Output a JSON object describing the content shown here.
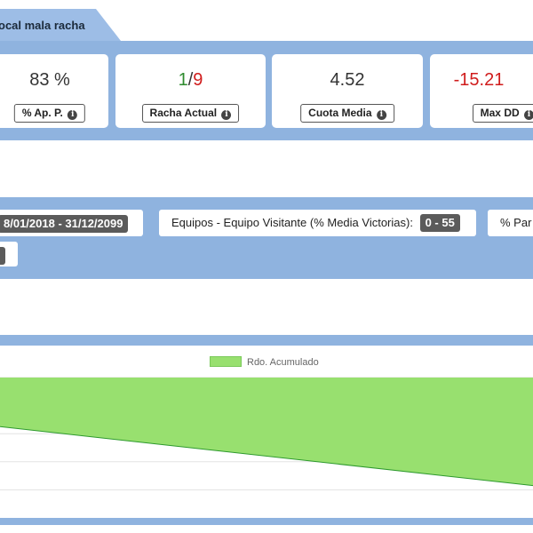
{
  "header": {
    "tab_title": "ocal mala racha"
  },
  "stats": [
    {
      "value": "83 %",
      "label": "% Ap. P."
    },
    {
      "value_a": "1",
      "value_sep": "/",
      "value_b": "9",
      "label": "Racha Actual"
    },
    {
      "value": "4.52",
      "label": "Cuota Media"
    },
    {
      "value": "-15.21",
      "label": "Max DD"
    }
  ],
  "filters": {
    "date_range": "8/01/2018 - 31/12/2099",
    "teams_label": "Equipos - Equipo Visitante (% Media Victorias):",
    "teams_range": "0 - 55",
    "partial_label": "% Par"
  },
  "colors": {
    "band": "#8fb3df",
    "area_fill": "#98e06f",
    "area_line": "#2e9a2e",
    "positive": "#2e8b2e",
    "negative": "#d01c1c"
  },
  "chart_data": {
    "type": "area",
    "series": [
      {
        "name": "Rdo. Acumulado",
        "x": [
          0,
          1
        ],
        "values": [
          0.65,
          0.23
        ]
      }
    ],
    "ylim": [
      0,
      1
    ],
    "grid": true,
    "legend": "top"
  }
}
